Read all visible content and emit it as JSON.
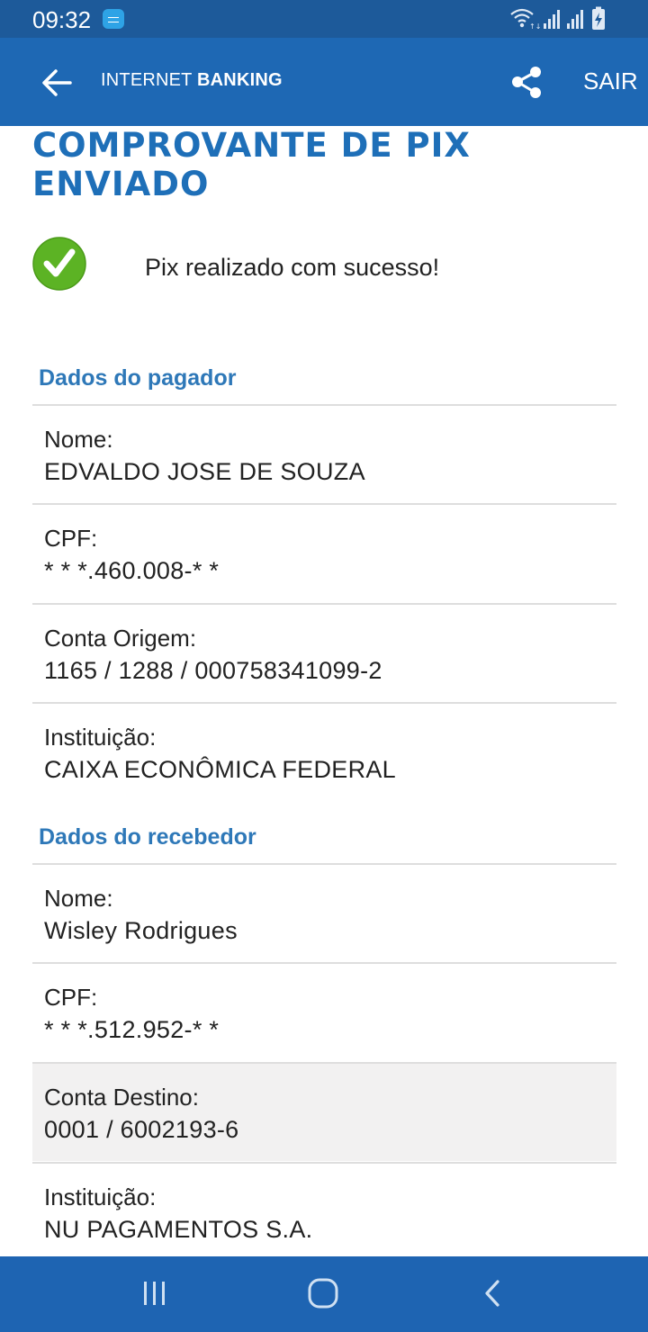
{
  "status_bar": {
    "time": "09:32"
  },
  "app_bar": {
    "title_prefix": "INTERNET",
    "title_bold": "BANKING",
    "exit_label": "SAIR"
  },
  "page": {
    "title": "COMPROVANTE DE PIX ENVIADO",
    "success_message": "Pix realizado com sucesso!"
  },
  "payer": {
    "section_title": "Dados do pagador",
    "fields": [
      {
        "label": "Nome:",
        "value": "EDVALDO JOSE DE SOUZA"
      },
      {
        "label": "CPF:",
        "value": "* * *.460.008-* *"
      },
      {
        "label": "Conta Origem:",
        "value": "1165 / 1288 / 000758341099-2"
      },
      {
        "label": "Instituição:",
        "value": "CAIXA ECONÔMICA FEDERAL"
      }
    ]
  },
  "receiver": {
    "section_title": "Dados do recebedor",
    "fields": [
      {
        "label": "Nome:",
        "value": "Wisley Rodrigues"
      },
      {
        "label": "CPF:",
        "value": "* * *.512.952-* *"
      },
      {
        "label": "Conta Destino:",
        "value": "0001 / 6002193-6"
      },
      {
        "label": "Instituição:",
        "value": "NU PAGAMENTOS S.A."
      }
    ]
  },
  "colors": {
    "status_bar": "#1d5a9a",
    "app_bar": "#1e68b4",
    "title": "#1e6fb8",
    "section": "#2e78b8",
    "success": "#5cb324",
    "nav_bar": "#1e64b2"
  },
  "icons": {
    "back": "arrow-left-icon",
    "share": "share-icon",
    "success": "check-circle-icon",
    "nav_recents": "recents-icon",
    "nav_home": "home-icon",
    "nav_back": "chevron-left-icon"
  }
}
